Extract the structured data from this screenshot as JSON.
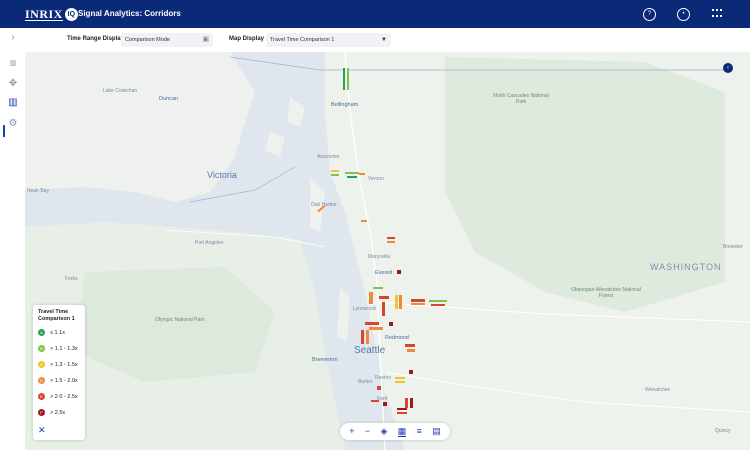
{
  "header": {
    "brand": "INRIX",
    "brand_badge": "IQ",
    "app_title": "Signal Analytics: Corridors",
    "help_icon": "question-circle-icon",
    "user_icon": "user-avatar-icon",
    "apps_icon": "apps-grid-icon"
  },
  "sidebar": {
    "items": [
      {
        "icon": "chevron-right-icon"
      },
      {
        "icon": "map-pin-icon"
      },
      {
        "icon": "crosshair-icon"
      },
      {
        "icon": "columns-icon",
        "active": true
      },
      {
        "icon": "gear-icon"
      }
    ]
  },
  "controls": {
    "time_range_label": "Time Range Display",
    "time_range_value": "Comparison Mode",
    "map_display_label": "Map Display",
    "map_display_value": "Travel Time Comparison 1"
  },
  "map": {
    "labels": {
      "lake_cowichan": "Lake Cowichan",
      "duncan": "Duncan",
      "bellingham": "Bellingham",
      "north_cascades": "North Cascades National Park",
      "victoria": "Victoria",
      "anacortes": "Anacortes",
      "vernon": "Vernon",
      "oak_harbor": "Oak Harbor",
      "port_angeles": "Port Angeles",
      "forks": "Forks",
      "olympic": "Olympic National Park",
      "marysville": "Marysville",
      "everett": "Everett",
      "okanogan": "Okanogan-Wenatchee National Forest",
      "washington": "WASHINGTON",
      "brewster": "Brewster",
      "lynnwood": "Lynnwood",
      "redmond": "Redmond",
      "seattle": "Seattle",
      "bremerton": "Bremerton",
      "renton": "Renton",
      "burien": "Burien",
      "kent": "Kent",
      "wenatchee": "Wenatchee",
      "quincy": "Quincy",
      "neah_bay": "Neah Bay"
    }
  },
  "legend": {
    "title": "Travel Time Comparison 1",
    "items": [
      {
        "grade": "A",
        "label": "≤ 1.1x",
        "color": "#2e9e4f"
      },
      {
        "grade": "B",
        "label": "> 1.1 - 1.3x",
        "color": "#7cc44a"
      },
      {
        "grade": "C",
        "label": "> 1.3 - 1.5x",
        "color": "#f2c230"
      },
      {
        "grade": "D",
        "label": "> 1.5 - 2.0x",
        "color": "#ef8a3c"
      },
      {
        "grade": "E",
        "label": "> 2.0 - 2.5x",
        "color": "#d8442e"
      },
      {
        "grade": "F",
        "label": "> 2.5x",
        "color": "#9a1b1b"
      }
    ],
    "close_label": "✕"
  },
  "toolbar": {
    "zoom_in": "+",
    "zoom_out": "−",
    "layers": "◈",
    "map_view": "▦",
    "list_view": "≡",
    "chart_view": "▤"
  }
}
